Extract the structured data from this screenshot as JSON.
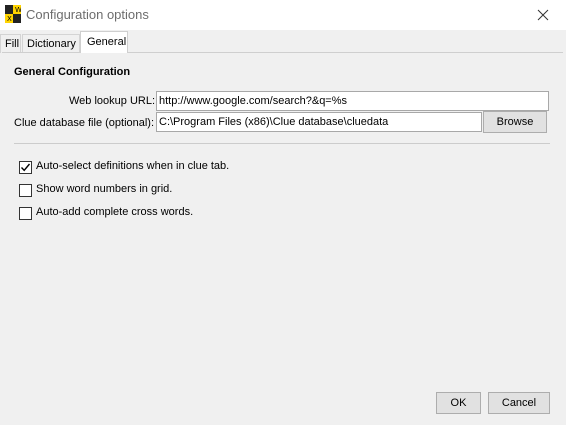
{
  "window": {
    "title": "Configuration options",
    "app_icon": "crossword-grid-icon",
    "close_icon": "close-icon"
  },
  "tabs": [
    {
      "label": "Fill",
      "active": false
    },
    {
      "label": "Dictionary",
      "active": false
    },
    {
      "label": "General",
      "active": true
    }
  ],
  "general": {
    "section_title": "General Configuration",
    "web_lookup": {
      "label": "Web lookup URL:",
      "value": "http://www.google.com/search?&q=%s"
    },
    "clue_db": {
      "label": "Clue database file (optional):",
      "value": "C:\\Program Files (x86)\\Clue database\\cluedata",
      "browse_label": "Browse"
    },
    "options": [
      {
        "label": "Auto-select definitions when in clue tab.",
        "checked": true
      },
      {
        "label": "Show word numbers in grid.",
        "checked": false
      },
      {
        "label": "Auto-add complete cross words.",
        "checked": false
      }
    ]
  },
  "footer": {
    "ok_label": "OK",
    "cancel_label": "Cancel"
  },
  "colors": {
    "window_bg": "#f0f0f0",
    "titlebar_bg": "#ffffff",
    "icon_yellow": "#ffd400"
  }
}
